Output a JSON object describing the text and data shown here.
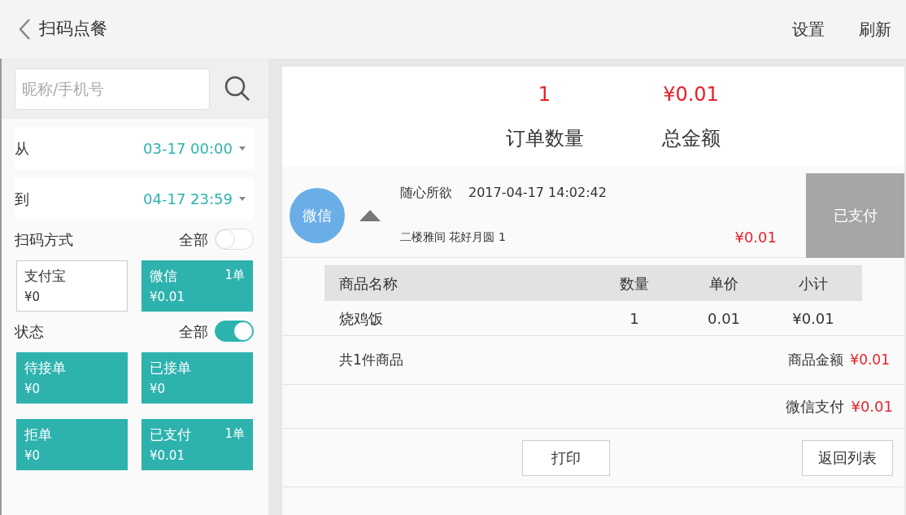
{
  "header": {
    "title": "扫码点餐",
    "actions": [
      "设置",
      "刷新"
    ]
  },
  "search": {
    "placeholder": "昵称/手机号"
  },
  "date_range": [
    {
      "label": "从",
      "value": "03-17 00:00"
    },
    {
      "label": "到",
      "value": "04-17 23:59"
    }
  ],
  "filter_groups": [
    {
      "title": "扫码方式",
      "all_label": "全部",
      "all_on": false,
      "tiles": [
        {
          "name": "支付宝",
          "amount": "¥0",
          "selected": false
        },
        {
          "name": "微信",
          "count": "1单",
          "amount": "¥0.01",
          "selected": true
        }
      ]
    },
    {
      "title": "状态",
      "all_label": "全部",
      "all_on": true,
      "tiles": [
        {
          "name": "待接单",
          "amount": "¥0",
          "selected": true
        },
        {
          "name": "已接单",
          "amount": "¥0",
          "selected": true
        },
        {
          "name": "拒单",
          "amount": "¥0",
          "selected": true
        },
        {
          "name": "已支付",
          "count": "1单",
          "amount": "¥0.01",
          "selected": true
        }
      ]
    }
  ],
  "summary": [
    {
      "value": "1",
      "label": "订单数量"
    },
    {
      "value": "¥0.01",
      "label": "总金额"
    }
  ],
  "order": {
    "badge": "微信",
    "expanded": true,
    "customer": "随心所欲",
    "time": "2017-04-17 14:02:42",
    "table_name": "二楼雅间 花好月圆 1",
    "amount": "¥0.01",
    "status": "已支付"
  },
  "items": {
    "columns": [
      "商品名称",
      "数量",
      "单价",
      "小计"
    ],
    "rows": [
      [
        "烧鸡饭",
        "1",
        "0.01",
        "¥0.01"
      ]
    ]
  },
  "totals": {
    "count_text": "共1件商品",
    "goods_label": "商品金额",
    "goods_amount": "¥0.01",
    "pay_label": "微信支付",
    "pay_amount": "¥0.01"
  },
  "buttons": [
    "打印",
    "返回列表"
  ]
}
